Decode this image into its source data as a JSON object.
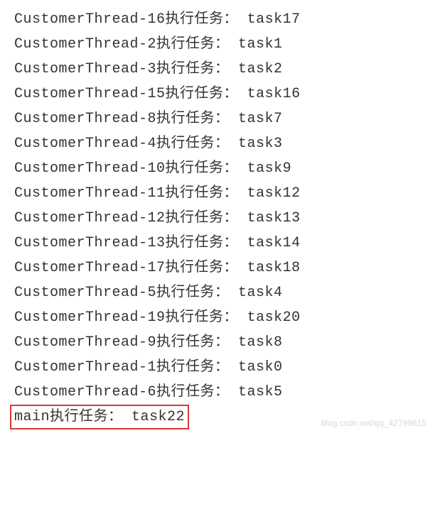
{
  "logs": [
    {
      "thread": "CustomerThread-16",
      "label": "执行任务：",
      "task": "task17",
      "highlighted": false
    },
    {
      "thread": "CustomerThread-2",
      "label": "执行任务：",
      "task": "task1",
      "highlighted": false
    },
    {
      "thread": "CustomerThread-3",
      "label": "执行任务：",
      "task": "task2",
      "highlighted": false
    },
    {
      "thread": "CustomerThread-15",
      "label": "执行任务：",
      "task": "task16",
      "highlighted": false
    },
    {
      "thread": "CustomerThread-8",
      "label": "执行任务：",
      "task": "task7",
      "highlighted": false
    },
    {
      "thread": "CustomerThread-4",
      "label": "执行任务：",
      "task": "task3",
      "highlighted": false
    },
    {
      "thread": "CustomerThread-10",
      "label": "执行任务：",
      "task": "task9",
      "highlighted": false
    },
    {
      "thread": "CustomerThread-11",
      "label": "执行任务：",
      "task": "task12",
      "highlighted": false
    },
    {
      "thread": "CustomerThread-12",
      "label": "执行任务：",
      "task": "task13",
      "highlighted": false
    },
    {
      "thread": "CustomerThread-13",
      "label": "执行任务：",
      "task": "task14",
      "highlighted": false
    },
    {
      "thread": "CustomerThread-17",
      "label": "执行任务：",
      "task": "task18",
      "highlighted": false
    },
    {
      "thread": "CustomerThread-5",
      "label": "执行任务：",
      "task": "task4",
      "highlighted": false
    },
    {
      "thread": "CustomerThread-19",
      "label": "执行任务：",
      "task": "task20",
      "highlighted": false
    },
    {
      "thread": "CustomerThread-9",
      "label": "执行任务：",
      "task": "task8",
      "highlighted": false
    },
    {
      "thread": "CustomerThread-1",
      "label": "执行任务：",
      "task": "task0",
      "highlighted": false
    },
    {
      "thread": "CustomerThread-6",
      "label": "执行任务：",
      "task": "task5",
      "highlighted": false
    },
    {
      "thread": "main",
      "label": "执行任务：",
      "task": "task22",
      "highlighted": true
    }
  ],
  "watermark": "blog.csdn.net/qq_42799615"
}
